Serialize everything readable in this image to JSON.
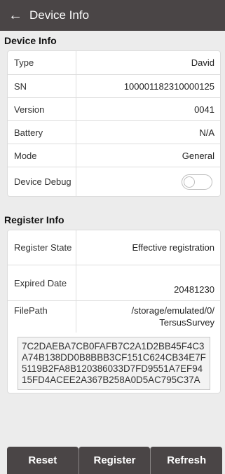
{
  "header": {
    "back_icon": "arrow-left-icon",
    "title": "Device Info"
  },
  "device_info": {
    "section_title": "Device Info",
    "rows": [
      {
        "label": "Type",
        "value": "David"
      },
      {
        "label": "SN",
        "value": "100001182310000125"
      },
      {
        "label": "Version",
        "value": "0041"
      },
      {
        "label": "Battery",
        "value": "N/A"
      },
      {
        "label": "Mode",
        "value": "General"
      },
      {
        "label": "Device Debug",
        "toggle": "off"
      }
    ]
  },
  "register_info": {
    "section_title": "Register Info",
    "rows": [
      {
        "label": "Register State",
        "value": "Effective registration"
      },
      {
        "label": "Expired Date",
        "value": "20481230"
      },
      {
        "label": "FilePath",
        "value": "/storage/emulated/0/ TersusSurvey"
      }
    ],
    "code": "7C2DAEBA7CB0FAFB7C2A1D2BB45F4C3A74B138DD0B8BBB3CF151C624CB34E7F5119B2FA8B120386033D7FD9551A7EF9415FD4ACEE2A367B258A0D5AC795C37A"
  },
  "buttons": {
    "reset": "Reset",
    "register": "Register",
    "refresh": "Refresh"
  },
  "colors": {
    "appbar": "#4a4546",
    "background": "#ececec"
  }
}
